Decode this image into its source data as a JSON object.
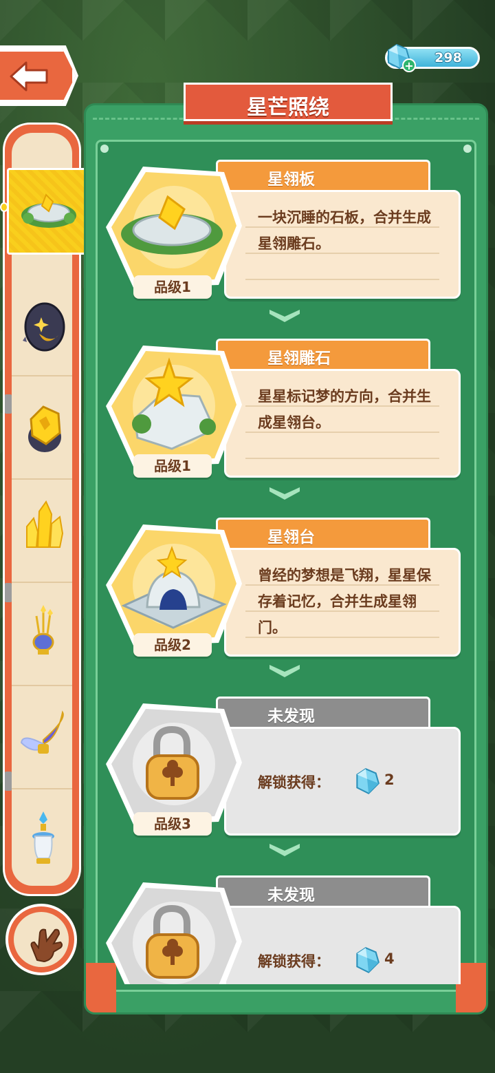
{
  "header": {
    "back_icon": "back-arrow-icon",
    "gems": "298",
    "gem_icon": "blue-gem-icon",
    "title": "星芒照绕"
  },
  "sidebar": {
    "items": [
      {
        "icon": "stone-slab-icon",
        "active": true
      },
      {
        "icon": "dark-rock-icon"
      },
      {
        "icon": "gold-ore-icon"
      },
      {
        "icon": "gold-crystal-icon"
      },
      {
        "icon": "gold-vase-icon"
      },
      {
        "icon": "butterfly-wing-icon"
      },
      {
        "icon": "blue-lamp-icon"
      }
    ],
    "hand_icon": "pointing-hand-icon"
  },
  "entries": [
    {
      "name": "星翎板",
      "desc": "一块沉睡的石板，合并生成星翎雕石。",
      "grade": "品级1",
      "icon": "stone-slab-icon"
    },
    {
      "name": "星翎雕石",
      "desc": "星星标记梦的方向，合并生成星翎台。",
      "grade": "品级1",
      "icon": "star-rock-icon"
    },
    {
      "name": "星翎台",
      "desc": "曾经的梦想是飞翔，星星保存着记忆，合并生成星翎门。",
      "grade": "品级2",
      "icon": "star-altar-icon"
    },
    {
      "name": "未发现",
      "unlock_label": "解锁获得：",
      "reward": "2",
      "grade": "品级3",
      "icon": "padlock-icon",
      "locked": true
    },
    {
      "name": "未发现",
      "unlock_label": "解锁获得：",
      "reward": "4",
      "grade": "",
      "icon": "padlock-icon",
      "locked": true
    }
  ],
  "colors": {
    "accent_orange": "#e9673f",
    "panel_green": "#3aa065",
    "tab_orange": "#f49a3c",
    "card_cream": "#fae8cf",
    "text_brown": "#6b3c1f"
  }
}
